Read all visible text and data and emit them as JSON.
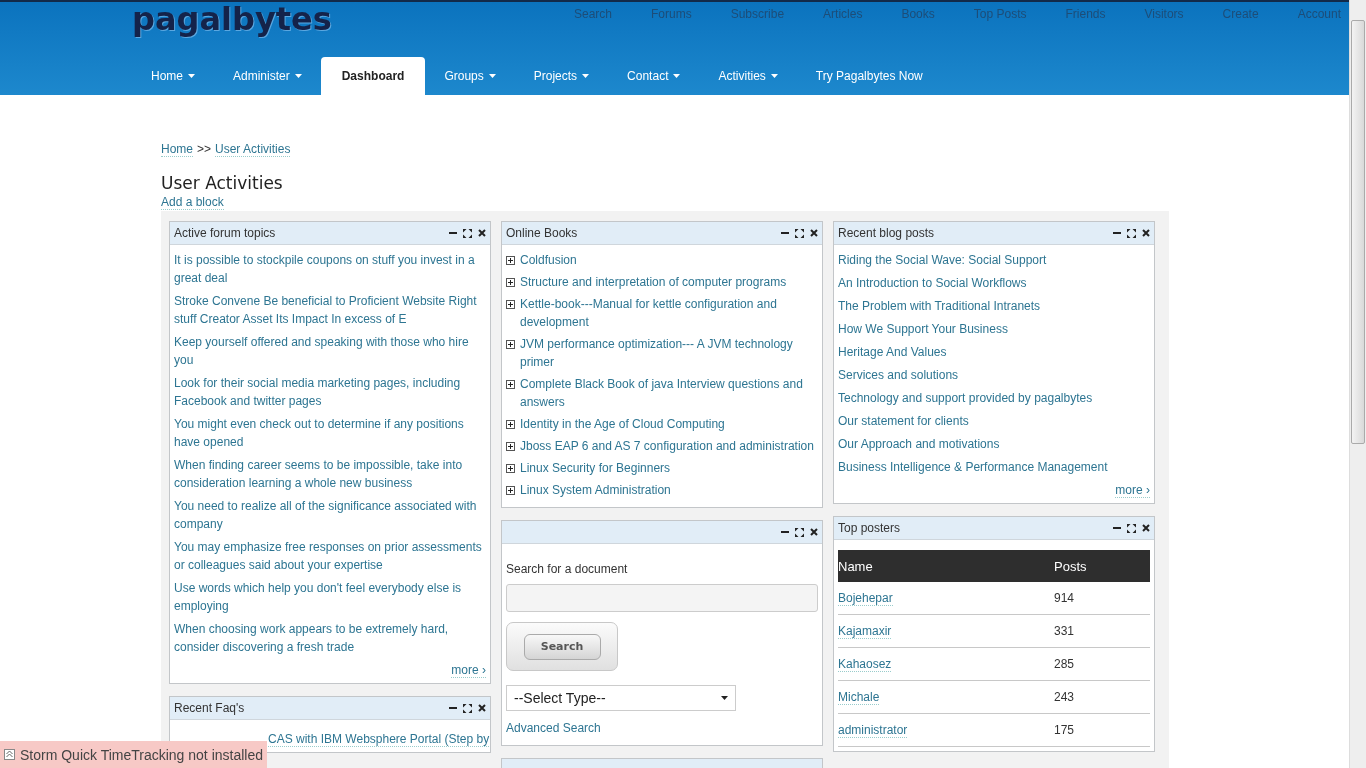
{
  "logo": "pagalbytes",
  "top_links": [
    "Search",
    "Forums",
    "Subscribe",
    "Articles",
    "Books",
    "Top Posts",
    "Friends",
    "Visitors",
    "Create",
    "Account"
  ],
  "main_nav": [
    {
      "label": "Home",
      "dropdown": true,
      "selected": false
    },
    {
      "label": "Administer",
      "dropdown": true,
      "selected": false
    },
    {
      "label": "Dashboard",
      "dropdown": false,
      "selected": true
    },
    {
      "label": "Groups",
      "dropdown": true,
      "selected": false
    },
    {
      "label": "Projects",
      "dropdown": true,
      "selected": false
    },
    {
      "label": "Contact",
      "dropdown": true,
      "selected": false
    },
    {
      "label": "Activities",
      "dropdown": true,
      "selected": false
    },
    {
      "label": "Try Pagalbytes Now",
      "dropdown": false,
      "selected": false
    }
  ],
  "breadcrumb": {
    "items": [
      "Home",
      "User Activities"
    ],
    "separator": ">>"
  },
  "page_title": "User Activities",
  "add_block": "Add a block",
  "columns": [
    [
      {
        "kind": "links",
        "title": "Active forum topics",
        "more": "more ›",
        "items": [
          "It is possible to stockpile coupons on stuff you invest in a great deal",
          "Stroke Convene Be beneficial to Proficient Website Right stuff Creator Asset Its Impact In excess of E",
          "Keep yourself offered and speaking with those who hire you",
          "Look for their social media marketing pages, including Facebook and twitter pages",
          "You might even check out to determine if any positions have opened",
          "When finding career seems to be impossible, take into consideration learning a whole new business",
          "You need to realize all of the significance associated with company",
          "You may emphasize free responses on prior assessments or colleagues said about your expertise",
          "Use words which help you don't feel everybody else is employing",
          "When choosing work appears to be extremely hard, consider discovering a fresh trade"
        ]
      },
      {
        "kind": "faq",
        "title": "Recent Faq's",
        "items": [
          "CAS with IBM Websphere Portal (Step by"
        ]
      }
    ],
    [
      {
        "kind": "books",
        "title": "Online Books",
        "items": [
          {
            "label": "Coldfusion",
            "expanded": false
          },
          {
            "label": "Structure and interpretation of computer programs",
            "expanded": false
          },
          {
            "label": "Kettle-book---Manual for kettle configuration and development",
            "expanded": false
          },
          {
            "label": "JVM performance optimization--- A JVM technology primer",
            "expanded": false
          },
          {
            "label": "Complete Black Book of java Interview questions and answers",
            "expanded": false
          },
          {
            "label": "Identity in the Age of Cloud Computing",
            "expanded": false
          },
          {
            "label": "Jboss EAP 6 and AS 7 configuration and administration",
            "expanded": false
          },
          {
            "label": "Linux Security for Beginners",
            "expanded": false
          },
          {
            "label": "Linux System Administration",
            "expanded": false
          }
        ]
      },
      {
        "kind": "search",
        "label": "Search for a document",
        "button": "Search",
        "select": "--Select Type--",
        "advanced": "Advanced Search"
      },
      {
        "kind": "empty"
      }
    ],
    [
      {
        "kind": "links",
        "title": "Recent blog posts",
        "more": "more ›",
        "items": [
          "Riding the Social Wave: Social Support",
          "An Introduction to Social Workflows",
          "The Problem with Traditional Intranets",
          "How We Support Your Business",
          "Heritage And Values",
          "Services and solutions",
          "Technology and support provided by pagalbytes",
          "Our statement for clients",
          "Our Approach and motivations",
          "Business Intelligence & Performance Management"
        ]
      },
      {
        "kind": "table",
        "title": "Top posters",
        "columns": [
          "Name",
          "Posts"
        ],
        "rows": [
          [
            "Bojehepar",
            "914"
          ],
          [
            "Kajamaxir",
            "331"
          ],
          [
            "Kahaosez",
            "285"
          ],
          [
            "Michale",
            "243"
          ],
          [
            "administrator",
            "175"
          ]
        ]
      }
    ]
  ],
  "notification": {
    "text": "Storm Quick TimeTracking not installed"
  }
}
